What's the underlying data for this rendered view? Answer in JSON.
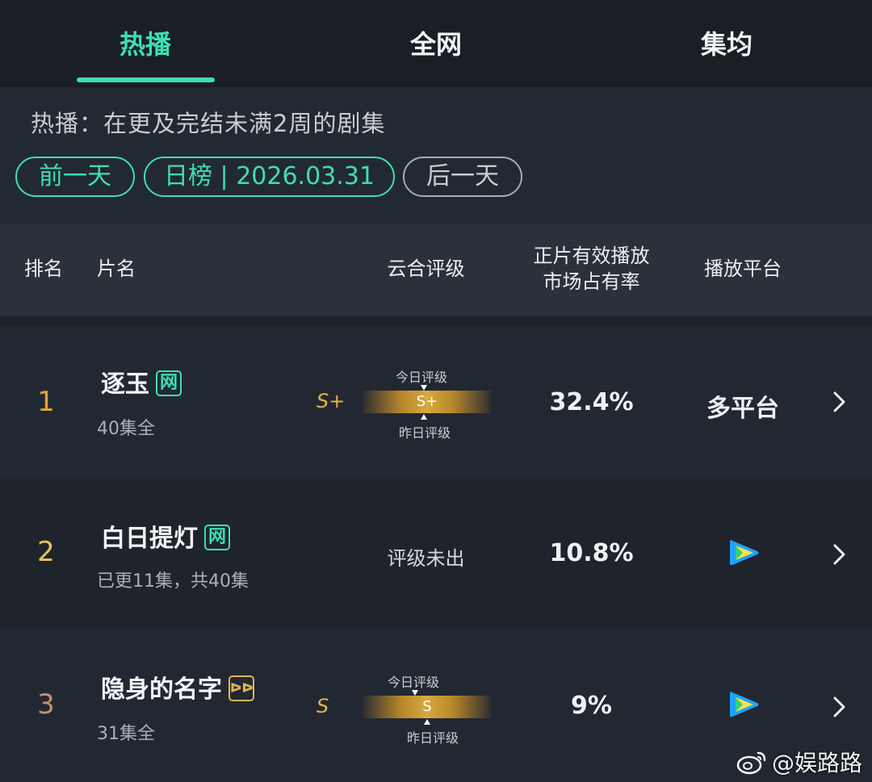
{
  "tabs": [
    {
      "label": "热播",
      "active": true
    },
    {
      "label": "全网",
      "active": false
    },
    {
      "label": "集均",
      "active": false
    }
  ],
  "filter": {
    "description": "热播：在更及完结未满2周的剧集",
    "prev_day": "前一天",
    "current": "日榜 | 2026.03.31",
    "next_day": "后一天"
  },
  "table_header": {
    "rank": "排名",
    "title": "片名",
    "rating": "云合评级",
    "share_line1": "正片有效播放",
    "share_line2": "市场占有率",
    "platform": "播放平台"
  },
  "rows": [
    {
      "rank": "1",
      "title": "逐玉",
      "badge": "网",
      "episodes": "40集全",
      "grade": "S+",
      "bar_grade": "S+",
      "today_label": "今日评级",
      "yesterday_label": "昨日评级",
      "share": "32.4%",
      "platform": "多平台"
    },
    {
      "rank": "2",
      "title": "白日提灯",
      "badge": "网",
      "episodes": "已更11集，共40集",
      "grade_text": "评级未出",
      "share": "10.8%",
      "platform_icon": "tencent-video-icon"
    },
    {
      "rank": "3",
      "title": "隐身的名字",
      "badge": "ᐅᐅ",
      "episodes": "31集全",
      "grade": "S",
      "bar_grade": "S",
      "today_label": "今日评级",
      "yesterday_label": "昨日评级",
      "share": "9%",
      "platform_icon": "tencent-video-icon"
    }
  ],
  "colors": {
    "accent": "#3ddfb1",
    "grade_gold": "#e6b24a",
    "rank1": "#e6a437",
    "rank2": "#e8c25a",
    "rank3": "#c98e6a"
  },
  "watermark": {
    "icon": "weibo-icon",
    "text": "@娱路路"
  }
}
